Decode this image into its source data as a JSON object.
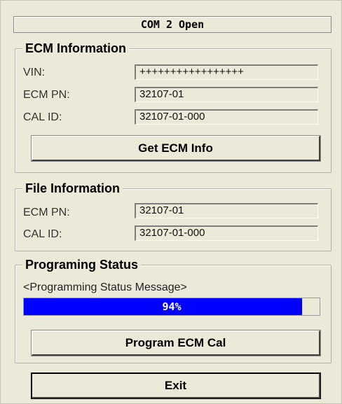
{
  "status": {
    "text": "COM 2 Open"
  },
  "ecm_info": {
    "title": "ECM Information",
    "vin_label": "VIN:",
    "vin_value": "+++++++++++++++++",
    "pn_label": "ECM PN:",
    "pn_value": "32107-01",
    "cal_label": "CAL ID:",
    "cal_value": "32107-01-000",
    "button": "Get ECM Info"
  },
  "file_info": {
    "title": "File Information",
    "pn_label": "ECM PN:",
    "pn_value": "32107-01",
    "cal_label": "CAL ID:",
    "cal_value": "32107-01-000"
  },
  "programming": {
    "title": "Programing Status",
    "message": "<Programming Status Message>",
    "progress_percent": 94,
    "progress_text": "94%",
    "progress_color": "#0000ff",
    "button": "Program ECM Cal"
  },
  "exit_button": "Exit"
}
